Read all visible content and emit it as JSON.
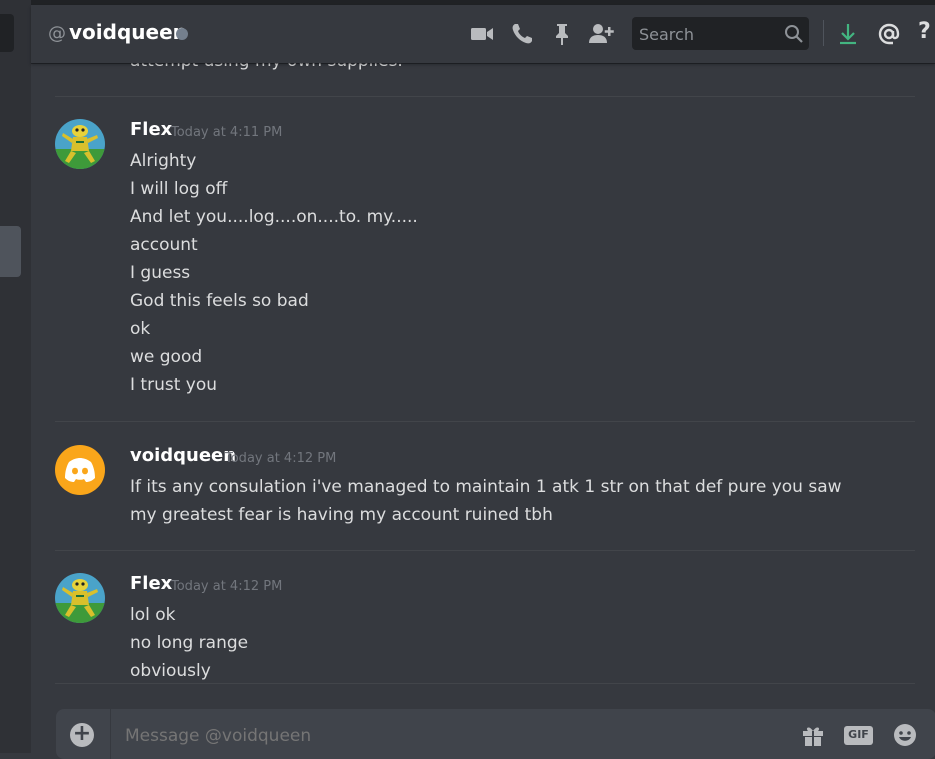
{
  "header": {
    "at_symbol": "@",
    "channel_name": "voidqueen",
    "search_placeholder": "Search",
    "help_label": "?"
  },
  "partial_top_line": "attempt using my own supplies.",
  "messages": [
    {
      "username": "Flex",
      "timestamp": "Today at 4:11 PM",
      "avatar": "frog-avatar",
      "lines": [
        "Alrighty",
        "I will log off",
        "And let you....log....on....to. my.....",
        "account",
        "I guess",
        "God this feels so bad",
        "ok",
        "we good",
        "I trust you"
      ]
    },
    {
      "username": "voidqueen",
      "timestamp": "Today at 4:12 PM",
      "avatar": "discord-default-avatar",
      "lines": [
        "If its any consulation i've managed to maintain 1 atk 1 str on that def pure you saw",
        "my greatest fear is having my account ruined tbh"
      ]
    },
    {
      "username": "Flex",
      "timestamp": "Today at 4:12 PM",
      "avatar": "frog-avatar",
      "lines": [
        "lol ok",
        "no long range",
        "obviously"
      ]
    }
  ],
  "composer": {
    "placeholder": "Message @voidqueen",
    "gif_label": "GIF"
  },
  "colors": {
    "background": "#36393f",
    "header_text": "#ffffff",
    "muted": "#72767d",
    "download_green": "#43b581",
    "discord_avatar_orange": "#faa61a"
  }
}
